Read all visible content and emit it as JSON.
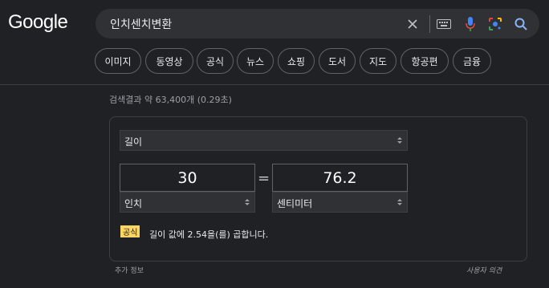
{
  "logo": "Google",
  "search": {
    "query": "인치센치변환"
  },
  "chips": [
    "이미지",
    "동영상",
    "공식",
    "뉴스",
    "쇼핑",
    "도서",
    "지도",
    "항공편",
    "금융"
  ],
  "stats": "검색결과 약 63,400개 (0.29초)",
  "converter": {
    "category": "길이",
    "from_value": "30",
    "from_unit": "인치",
    "equals": "=",
    "to_value": "76.2",
    "to_unit": "센티미터",
    "formula_badge": "공식",
    "formula_text": "길이 값에 2.54을(를) 곱합니다."
  },
  "footer": {
    "more_info": "추가 정보",
    "feedback": "사용자 의견"
  },
  "colors": {
    "background": "#202124",
    "search_bg": "#303134",
    "formula_badge": "#fdd663",
    "mic_blue": "#4285f4",
    "lens": "#ea4335"
  }
}
